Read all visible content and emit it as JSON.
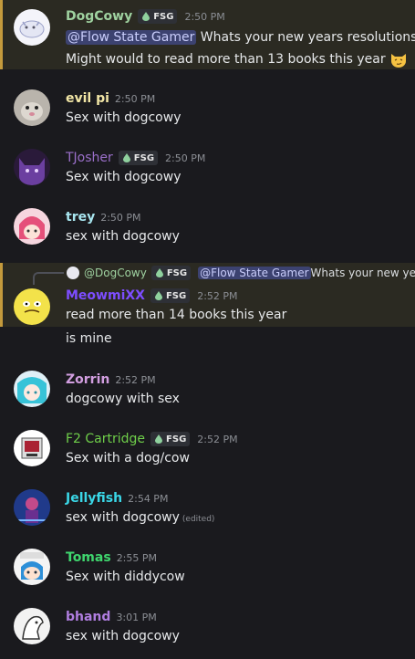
{
  "badge_label": "FSG",
  "colors": {
    "dogcowy": "#9fd2a0",
    "evilpi": "#f2e6a6",
    "tjosher": "#9a6fc9",
    "trey": "#a8e6f0",
    "meowmixx": "#7d4dff",
    "zorrin": "#d29ee0",
    "f2cartridge": "#6fcf4a",
    "jellyfish": "#3ad6e6",
    "tomas": "#3fd66e",
    "bhand": "#b07ee0"
  },
  "messages": [
    {
      "username": "DogCowy",
      "time": "2:50 PM",
      "mention": "@Flow State Gamer",
      "line1_text": " Whats your new years resolutions!!",
      "line2_text": "Might would to read more than 13 books this year",
      "emoji": "smirk-cat-emoji"
    },
    {
      "username": "evil pi",
      "time": "2:50 PM",
      "text": "Sex with dogcowy"
    },
    {
      "username": "TJosher",
      "time": "2:50 PM",
      "text": "Sex with dogcowy"
    },
    {
      "username": "trey",
      "time": "2:50 PM",
      "text": "sex with dogcowy"
    },
    {
      "reply_user": "@DogCowy",
      "reply_mention": "@Flow State Gamer",
      "reply_text": " Whats your new yea",
      "username": "MeowmiXX",
      "time": "2:52 PM",
      "text": "read more than 14 books this year",
      "text2": "is mine"
    },
    {
      "username": "Zorrin",
      "time": "2:52 PM",
      "text": "dogcowy with sex"
    },
    {
      "username": "F2 Cartridge",
      "time": "2:52 PM",
      "text": "Sex with a dog/cow"
    },
    {
      "username": "Jellyfish",
      "time": "2:54 PM",
      "text": "sex with dogcowy",
      "edited": "(edited)"
    },
    {
      "username": "Tomas",
      "time": "2:55 PM",
      "text": "Sex with diddycow"
    },
    {
      "username": "bhand",
      "time": "3:01 PM",
      "text": "sex with dogcowy"
    }
  ]
}
